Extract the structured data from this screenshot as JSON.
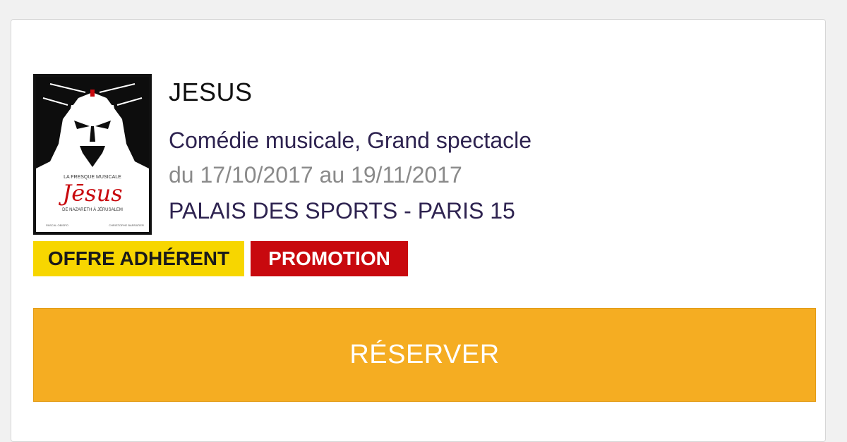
{
  "event": {
    "title": "JESUS",
    "genre": "Comédie musicale, Grand spectacle",
    "dates": "du 17/10/2017 au 19/11/2017",
    "venue": "PALAIS DES SPORTS - PARIS 15"
  },
  "poster": {
    "overline": "LA FRESQUE MUSICALE",
    "title": "Jēsus",
    "subtitle": "DE NAZARETH À JÉRUSALEM",
    "credit_left": "PASCAL OBISPO",
    "credit_right": "CHRISTOPHE BARRATIER"
  },
  "badges": {
    "member_offer": "OFFRE ADHÉRENT",
    "promotion": "PROMOTION"
  },
  "actions": {
    "reserve_label": "RÉSERVER"
  },
  "colors": {
    "accent_button": "#f5ad22",
    "member_badge": "#f7d600",
    "promo_badge": "#c8090e",
    "link_text": "#2e2350"
  }
}
